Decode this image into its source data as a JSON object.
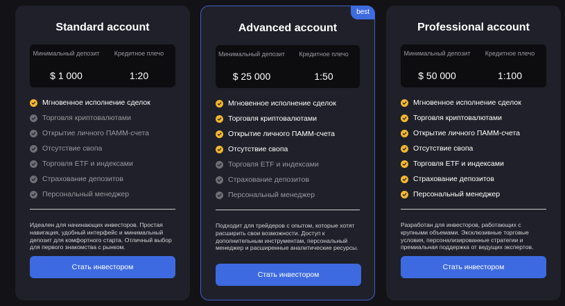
{
  "colors": {
    "accent": "#3d6ae0",
    "check_active": "#f3b62f",
    "check_inactive": "#6e6e74",
    "card_bg": "#1f2029"
  },
  "icons": {
    "feature_check": "check-icon"
  },
  "plans": [
    {
      "title": "Standard account",
      "badge": "",
      "deposit_label": "Минимальный депозит",
      "deposit_value": "$ 1 000",
      "leverage_label": "Кредитное плечо",
      "leverage_value": "1:20",
      "features": [
        {
          "text": "Мгновенное исполнение сделок",
          "active": true
        },
        {
          "text": "Торговля криптовалютами",
          "active": false
        },
        {
          "text": "Открытие личного ПАММ-счета",
          "active": false
        },
        {
          "text": "Отсутствие свопа",
          "active": false
        },
        {
          "text": "Торговля ETF и индексами",
          "active": false
        },
        {
          "text": "Страхование депозитов",
          "active": false
        },
        {
          "text": "Персональный менеджер",
          "active": false
        }
      ],
      "description": "Идеален для начинающих инвесторов. Простая навигация, удобный интерфейс и минимальный депозит для комфортного старта. Отличный выбор для первого знакомства с рынком.",
      "button_label": "Стать инвестором"
    },
    {
      "title": "Advanced account",
      "badge": "best",
      "deposit_label": "Минимальный депозит",
      "deposit_value": "$ 25 000",
      "leverage_label": "Кредитное плечо",
      "leverage_value": "1:50",
      "features": [
        {
          "text": "Мгновенное исполнение сделок",
          "active": true
        },
        {
          "text": "Торговля криптовалютами",
          "active": true
        },
        {
          "text": "Открытие личного ПАММ-счета",
          "active": true
        },
        {
          "text": "Отсутствие свопа",
          "active": true
        },
        {
          "text": "Торговля ETF и индексами",
          "active": false
        },
        {
          "text": "Страхование депозитов",
          "active": false
        },
        {
          "text": "Персональный менеджер",
          "active": false
        }
      ],
      "description": "Подходит для трейдеров с опытом, которые хотят расширить свои возможности. Доступ к дополнительным инструментам, персональный менеджер и расширенные аналитические ресурсы.",
      "button_label": "Стать инвестором"
    },
    {
      "title": "Professional account",
      "badge": "",
      "deposit_label": "Минимальный депозит",
      "deposit_value": "$ 50 000",
      "leverage_label": "Кредитное плечо",
      "leverage_value": "1:100",
      "features": [
        {
          "text": "Мгновенное исполнение сделок",
          "active": true
        },
        {
          "text": "Торговля криптовалютами",
          "active": true
        },
        {
          "text": "Открытие личного ПАММ-счета",
          "active": true
        },
        {
          "text": "Отсутствие свопа",
          "active": true
        },
        {
          "text": "Торговля ETF и индексами",
          "active": true
        },
        {
          "text": "Страхование депозитов",
          "active": true
        },
        {
          "text": "Персональный менеджер",
          "active": true
        }
      ],
      "description": "Разработан для инвесторов, работающих с крупными объемами. Эксклюзивные торговые условия, персонализированные стратегии и премиальная поддержка от ведущих экспертов.",
      "button_label": "Стать инвестором"
    }
  ]
}
